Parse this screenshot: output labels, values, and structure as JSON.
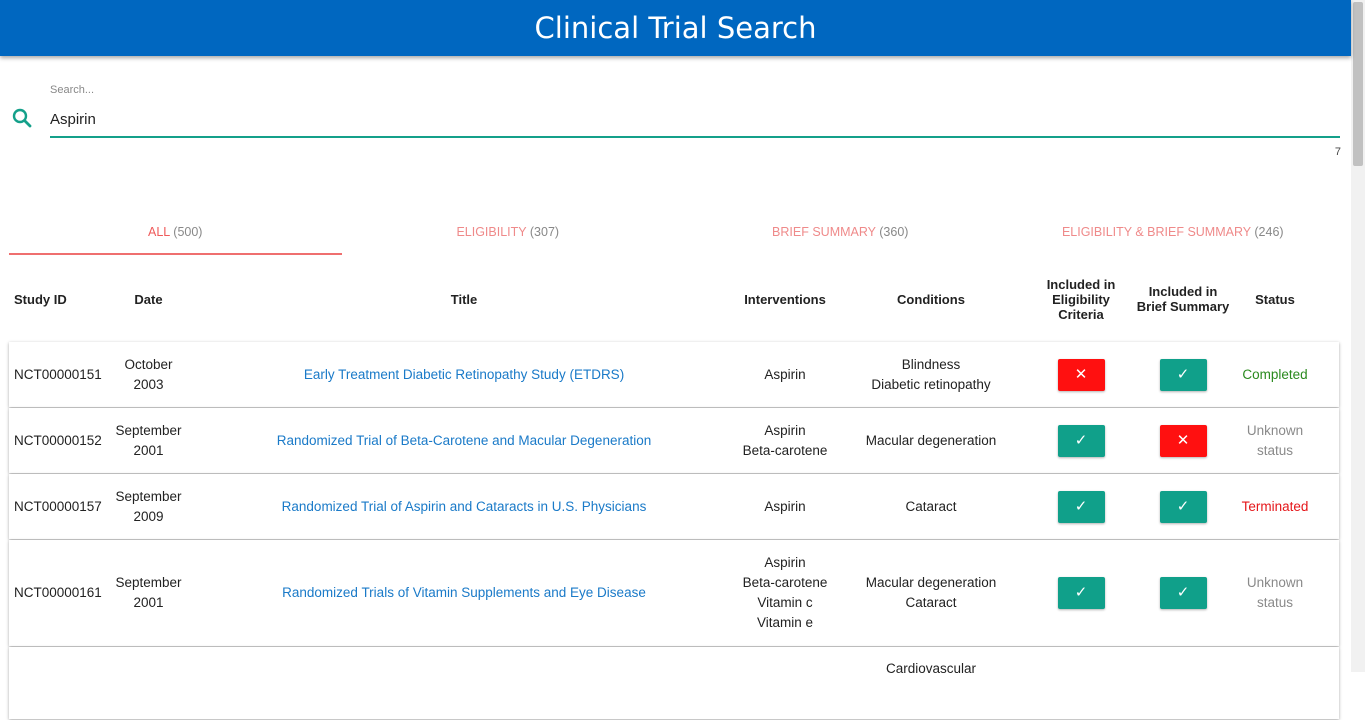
{
  "header": {
    "title": "Clinical Trial Search"
  },
  "search": {
    "label": "Search...",
    "value": "Aspirin",
    "char_count": "7"
  },
  "tabs": [
    {
      "label": "ALL",
      "count": "(500)"
    },
    {
      "label": "ELIGIBILITY",
      "count": "(307)"
    },
    {
      "label": "BRIEF SUMMARY",
      "count": "(360)"
    },
    {
      "label": "ELIGIBILITY & BRIEF SUMMARY",
      "count": "(246)"
    }
  ],
  "columns": {
    "study_id": "Study ID",
    "date": "Date",
    "title": "Title",
    "interventions": "Interventions",
    "conditions": "Conditions",
    "eligibility": "Included in Eligibility Criteria",
    "brief": "Included in Brief Summary",
    "status": "Status"
  },
  "rows": [
    {
      "id": "NCT00000151",
      "date": "October 2003",
      "title": "Early Treatment Diabetic Retinopathy Study (ETDRS)",
      "interventions": [
        "Aspirin"
      ],
      "conditions": [
        "Blindness",
        "Diabetic retinopathy"
      ],
      "eligibility": "✕",
      "brief": "✓",
      "status": "Completed"
    },
    {
      "id": "NCT00000152",
      "date": "September 2001",
      "title": "Randomized Trial of Beta-Carotene and Macular Degeneration",
      "interventions": [
        "Aspirin",
        "Beta-carotene"
      ],
      "conditions": [
        "Macular degeneration"
      ],
      "eligibility": "✓",
      "brief": "✕",
      "status": "Unknown status"
    },
    {
      "id": "NCT00000157",
      "date": "September 2009",
      "title": "Randomized Trial of Aspirin and Cataracts in U.S. Physicians",
      "interventions": [
        "Aspirin"
      ],
      "conditions": [
        "Cataract"
      ],
      "eligibility": "✓",
      "brief": "✓",
      "status": "Terminated"
    },
    {
      "id": "NCT00000161",
      "date": "September 2001",
      "title": "Randomized Trials of Vitamin Supplements and Eye Disease",
      "interventions": [
        "Aspirin",
        "Beta-carotene",
        "Vitamin c",
        "Vitamin e"
      ],
      "conditions": [
        "Macular degeneration",
        "Cataract"
      ],
      "eligibility": "✓",
      "brief": "✓",
      "status": "Unknown status"
    },
    {
      "id": "",
      "date": "",
      "title": "",
      "interventions": [],
      "conditions": [
        "Cardiovascular"
      ],
      "eligibility": "",
      "brief": "",
      "status": ""
    }
  ],
  "colors": {
    "appbar": "#0067c0",
    "accent_teal": "#10a08a",
    "no_red": "#ff1010",
    "tab_active": "#ef5b5b",
    "link": "#1a7ac8"
  }
}
